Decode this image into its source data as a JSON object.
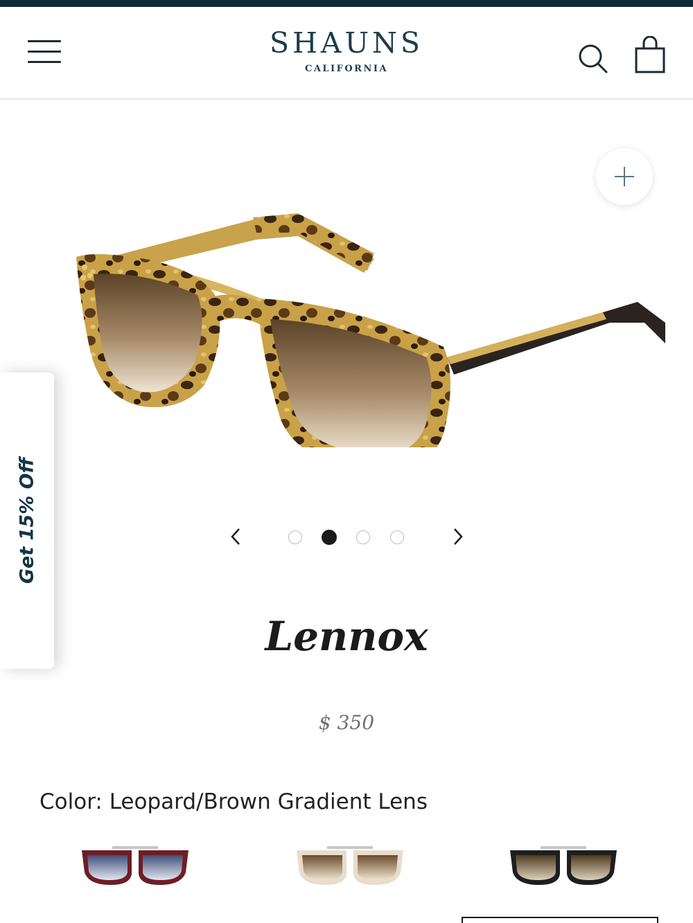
{
  "header": {
    "brand_name": "SHAUNS",
    "brand_tagline": "CALIFORNIA",
    "menu_icon": "hamburger-menu-icon",
    "search_icon": "search-icon",
    "cart_icon": "shopping-bag-icon",
    "accent_color": "#0d2a38",
    "brand_color": "#1d3d4d"
  },
  "gallery": {
    "current_image": 2,
    "image_count": 4,
    "zoom_icon": "plus-icon",
    "prev_icon": "chevron-left-icon",
    "next_icon": "chevron-right-icon"
  },
  "promo": {
    "label": "Get 15% Off",
    "color": "#123548"
  },
  "product": {
    "name": "Lennox",
    "price": "$ 350",
    "color_text": "Color: Leopard/Brown Gradient Lens"
  },
  "swatches": [
    {
      "icon": "burgundy-blue-gradient-sunglasses",
      "selected": false
    },
    {
      "icon": "clear-brown-gradient-sunglasses",
      "selected": false
    },
    {
      "icon": "black-brown-gradient-sunglasses",
      "selected": true
    }
  ]
}
